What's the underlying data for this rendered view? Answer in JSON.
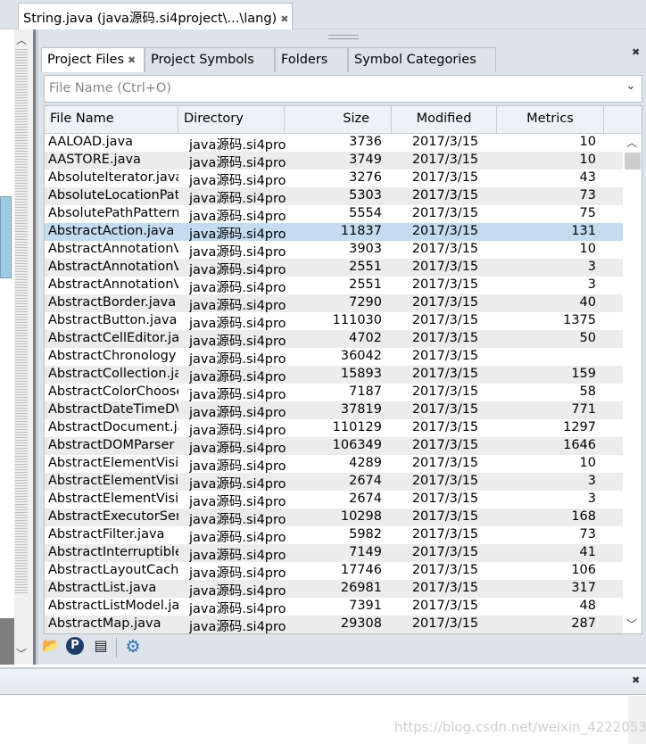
{
  "doc_tab": {
    "title": "String.java (java源码.si4project\\...\\lang)",
    "close": "✖"
  },
  "panel_tabs": [
    {
      "label": "Project Files",
      "close": "✖"
    },
    {
      "label": "Project Symbols"
    },
    {
      "label": "Folders"
    },
    {
      "label": "Symbol Categories"
    }
  ],
  "panel_close": "✖",
  "search": {
    "placeholder": "File Name (Ctrl+O)",
    "value": ""
  },
  "columns": [
    "File Name",
    "Directory",
    "Size",
    "Modified",
    "Metrics"
  ],
  "selected_index": 5,
  "rows": [
    [
      "AALOAD.java",
      "java源码.si4pro",
      "3736",
      "2017/3/15",
      "10"
    ],
    [
      "AASTORE.java",
      "java源码.si4pro",
      "3749",
      "2017/3/15",
      "10"
    ],
    [
      "AbsoluteIterator.java",
      "java源码.si4pro",
      "3276",
      "2017/3/15",
      "43"
    ],
    [
      "AbsoluteLocationPath",
      "java源码.si4pro",
      "5303",
      "2017/3/15",
      "73"
    ],
    [
      "AbsolutePathPattern",
      "java源码.si4pro",
      "5554",
      "2017/3/15",
      "75"
    ],
    [
      "AbstractAction.java",
      "java源码.si4pro",
      "11837",
      "2017/3/15",
      "131"
    ],
    [
      "AbstractAnnotationV",
      "java源码.si4pro",
      "3903",
      "2017/3/15",
      "10"
    ],
    [
      "AbstractAnnotationV",
      "java源码.si4pro",
      "2551",
      "2017/3/15",
      "3"
    ],
    [
      "AbstractAnnotationV",
      "java源码.si4pro",
      "2551",
      "2017/3/15",
      "3"
    ],
    [
      "AbstractBorder.java",
      "java源码.si4pro",
      "7290",
      "2017/3/15",
      "40"
    ],
    [
      "AbstractButton.java",
      "java源码.si4pro",
      "111030",
      "2017/3/15",
      "1375"
    ],
    [
      "AbstractCellEditor.java",
      "java源码.si4pro",
      "4702",
      "2017/3/15",
      "50"
    ],
    [
      "AbstractChronology",
      "java源码.si4pro",
      "36042",
      "2017/3/15",
      ""
    ],
    [
      "AbstractCollection.java",
      "java源码.si4pro",
      "15893",
      "2017/3/15",
      "159"
    ],
    [
      "AbstractColorChooser",
      "java源码.si4pro",
      "7187",
      "2017/3/15",
      "58"
    ],
    [
      "AbstractDateTimeDV",
      "java源码.si4pro",
      "37819",
      "2017/3/15",
      "771"
    ],
    [
      "AbstractDocument.java",
      "java源码.si4pro",
      "110129",
      "2017/3/15",
      "1297"
    ],
    [
      "AbstractDOMParser",
      "java源码.si4pro",
      "106349",
      "2017/3/15",
      "1646"
    ],
    [
      "AbstractElementVisitor",
      "java源码.si4pro",
      "4289",
      "2017/3/15",
      "10"
    ],
    [
      "AbstractElementVisitor",
      "java源码.si4pro",
      "2674",
      "2017/3/15",
      "3"
    ],
    [
      "AbstractElementVisitor",
      "java源码.si4pro",
      "2674",
      "2017/3/15",
      "3"
    ],
    [
      "AbstractExecutorService",
      "java源码.si4pro",
      "10298",
      "2017/3/15",
      "168"
    ],
    [
      "AbstractFilter.java",
      "java源码.si4pro",
      "5982",
      "2017/3/15",
      "73"
    ],
    [
      "AbstractInterruptible",
      "java源码.si4pro",
      "7149",
      "2017/3/15",
      "41"
    ],
    [
      "AbstractLayoutCache",
      "java源码.si4pro",
      "17746",
      "2017/3/15",
      "106"
    ],
    [
      "AbstractList.java",
      "java源码.si4pro",
      "26981",
      "2017/3/15",
      "317"
    ],
    [
      "AbstractListModel.java",
      "java源码.si4pro",
      "7391",
      "2017/3/15",
      "48"
    ],
    [
      "AbstractMap.java",
      "java源码.si4pro",
      "29308",
      "2017/3/15",
      "287"
    ]
  ],
  "toolbar": [
    "open-project-icon",
    "add-project-icon",
    "file-list-icon",
    "settings-gear-icon"
  ],
  "bottom_close": "✖",
  "watermark": "https://blog.csdn.net/weixin_42220532",
  "colors": {
    "selected_row": "#c5dbf0",
    "alt_row": "#ececec",
    "chrome": "#dde3ea"
  }
}
